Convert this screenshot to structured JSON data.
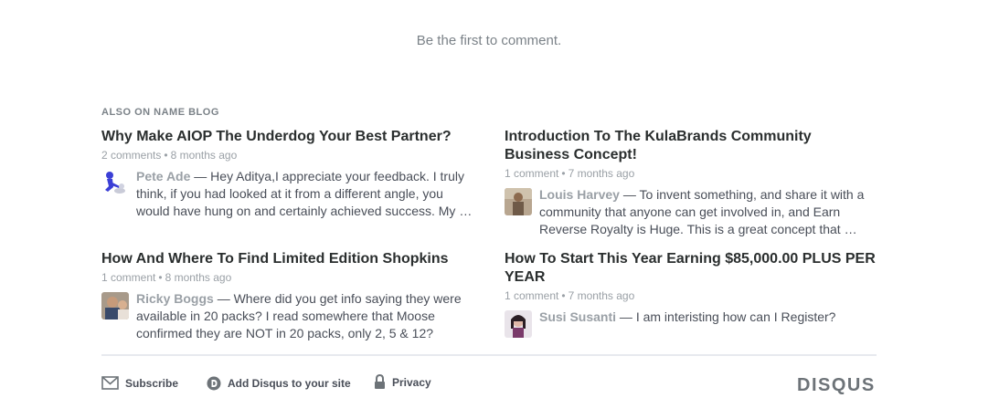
{
  "comments": {
    "empty_message": "Be the first to comment."
  },
  "recommendations": {
    "heading": "ALSO ON NAME BLOG",
    "items": [
      {
        "title": "Why Make AIOP The Underdog Your Best Partner?",
        "comment_count": "2 comments",
        "age": "8 months ago",
        "author": "Pete Ade",
        "snippet": "Hey Aditya,I appreciate your feedback. I truly think, if you had looked at it from a different angle, you would have hung on and certainly achieved success. My …",
        "avatar_icon": "blue-figure-avatar"
      },
      {
        "title": "Introduction To The KulaBrands Community Business Concept!",
        "comment_count": "1 comment",
        "age": "7 months ago",
        "author": "Louis Harvey",
        "snippet": "To invent something, and share it with a community that anyone can get involved in, and Earn Reverse Royalty is Huge. This is a great concept that …",
        "avatar_icon": "photo-avatar"
      },
      {
        "title": "How And Where To Find Limited Edition Shopkins",
        "comment_count": "1 comment",
        "age": "8 months ago",
        "author": "Ricky Boggs",
        "snippet": "Where did you get info saying they were available in 20 packs? I read somewhere that Moose confirmed they are NOT in 20 packs, only 2, 5 & 12?",
        "avatar_icon": "photo-avatar"
      },
      {
        "title": "How To Start This Year Earning $85,000.00 PLUS PER YEAR",
        "comment_count": "1 comment",
        "age": "7 months ago",
        "author": "Susi Susanti",
        "snippet": "I am interisting how can I Register?",
        "avatar_icon": "photo-avatar"
      }
    ],
    "separator": "•",
    "dash": "—"
  },
  "footer": {
    "subscribe_label": "Subscribe",
    "add_disqus_label": "Add Disqus to your site",
    "privacy_label": "Privacy",
    "logo_text": "DISQUS"
  },
  "colors": {
    "title": "#2a2e2e",
    "meta": "#9aa0a6",
    "body": "#494e58",
    "logo": "#6d7378"
  }
}
